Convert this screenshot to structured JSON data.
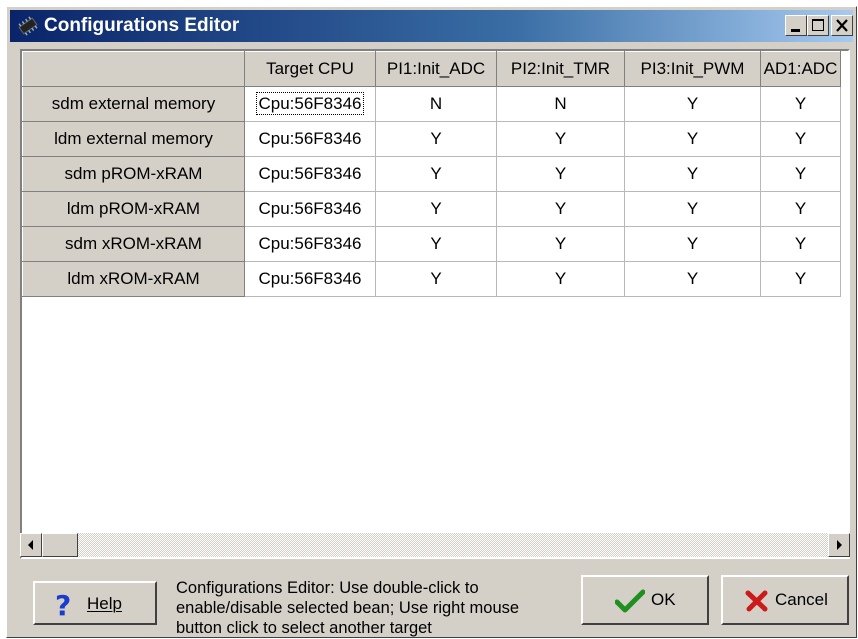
{
  "window": {
    "title": "Configurations Editor"
  },
  "grid": {
    "columns": [
      "Target CPU",
      "PI1:Init_ADC",
      "PI2:Init_TMR",
      "PI3:Init_PWM",
      "AD1:ADC"
    ],
    "rows": [
      {
        "name": "sdm external memory",
        "cells": [
          "Cpu:56F8346",
          "N",
          "N",
          "Y",
          "Y"
        ]
      },
      {
        "name": "ldm external memory",
        "cells": [
          "Cpu:56F8346",
          "Y",
          "Y",
          "Y",
          "Y"
        ]
      },
      {
        "name": "sdm pROM-xRAM",
        "cells": [
          "Cpu:56F8346",
          "Y",
          "Y",
          "Y",
          "Y"
        ]
      },
      {
        "name": "ldm pROM-xRAM",
        "cells": [
          "Cpu:56F8346",
          "Y",
          "Y",
          "Y",
          "Y"
        ]
      },
      {
        "name": "sdm xROM-xRAM",
        "cells": [
          "Cpu:56F8346",
          "Y",
          "Y",
          "Y",
          "Y"
        ]
      },
      {
        "name": "ldm xROM-xRAM",
        "cells": [
          "Cpu:56F8346",
          "Y",
          "Y",
          "Y",
          "Y"
        ]
      }
    ]
  },
  "footer": {
    "help_label": "Help",
    "hint_text": "Configurations Editor: Use double-click to enable/disable selected bean; Use right mouse button click to select another target",
    "ok_label": "OK",
    "cancel_label": "Cancel"
  },
  "icons": {
    "app": "chip-icon",
    "help": "question-mark-icon",
    "ok": "checkmark-icon",
    "cancel": "x-mark-icon"
  },
  "colors": {
    "title_bar": "#0a246a",
    "ok_check": "#1f8f1f",
    "cancel_x": "#cc1a1a"
  }
}
